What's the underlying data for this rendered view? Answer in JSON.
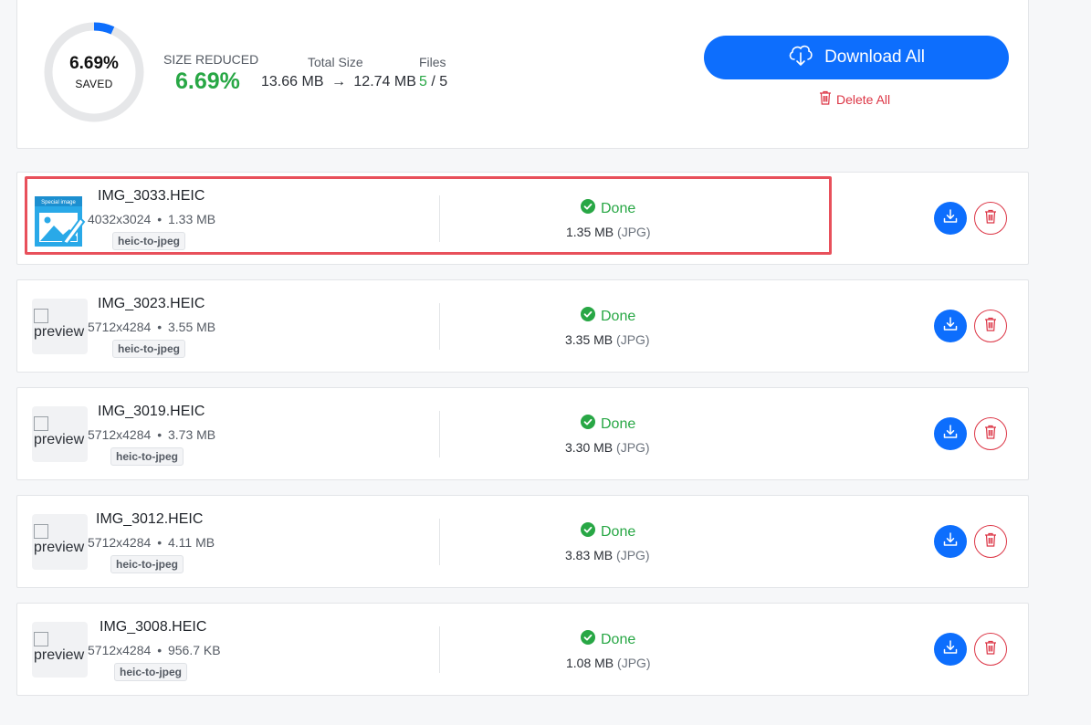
{
  "summary": {
    "ring_percent": "6.69%",
    "ring_label": "SAVED",
    "saved_fraction": 0.0669,
    "size_reduced_label": "SIZE REDUCED",
    "size_reduced_value": "6.69%",
    "total_size_label": "Total Size",
    "total_before": "13.66 MB",
    "arrow": "→",
    "total_after": "12.74 MB",
    "files_label": "Files",
    "files_done": "5",
    "files_sep": " / ",
    "files_total": "5",
    "download_all_label": "Download All",
    "delete_all_label": "Delete All"
  },
  "colors": {
    "accent": "#0d6efd",
    "success": "#28a745",
    "danger": "#dc3545",
    "highlight": "#e8505b"
  },
  "files": [
    {
      "name": "IMG_3033.HEIC",
      "dims": "4032x3024",
      "sep": "•",
      "size": "1.33 MB",
      "tag": "heic-to-jpeg",
      "status": "Done",
      "result_size": "1.35 MB",
      "result_format": "(JPG)",
      "thumb": "Special image",
      "preview_alt": "preview"
    },
    {
      "name": "IMG_3023.HEIC",
      "dims": "5712x4284",
      "sep": "•",
      "size": "3.55 MB",
      "tag": "heic-to-jpeg",
      "status": "Done",
      "result_size": "3.35 MB",
      "result_format": "(JPG)",
      "preview_alt": "preview"
    },
    {
      "name": "IMG_3019.HEIC",
      "dims": "5712x4284",
      "sep": "•",
      "size": "3.73 MB",
      "tag": "heic-to-jpeg",
      "status": "Done",
      "result_size": "3.30 MB",
      "result_format": "(JPG)",
      "preview_alt": "preview"
    },
    {
      "name": "IMG_3012.HEIC",
      "dims": "5712x4284",
      "sep": "•",
      "size": "4.11 MB",
      "tag": "heic-to-jpeg",
      "status": "Done",
      "result_size": "3.83 MB",
      "result_format": "(JPG)",
      "preview_alt": "preview"
    },
    {
      "name": "IMG_3008.HEIC",
      "dims": "5712x4284",
      "sep": "•",
      "size": "956.7 KB",
      "tag": "heic-to-jpeg",
      "status": "Done",
      "result_size": "1.08 MB",
      "result_format": "(JPG)",
      "preview_alt": "preview"
    }
  ]
}
